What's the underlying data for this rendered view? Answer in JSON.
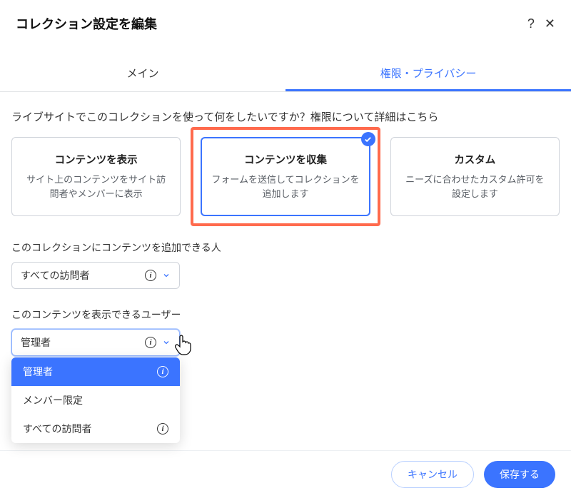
{
  "header": {
    "title": "コレクション設定を編集",
    "help": "?",
    "close": "✕"
  },
  "tabs": {
    "main": "メイン",
    "permissions": "権限・プライバシー"
  },
  "prompt": "ライブサイトでこのコレクションを使って何をしたいですか？権限について詳細はこちら",
  "cards": [
    {
      "title": "コンテンツを表示",
      "desc": "サイト上のコンテンツをサイト訪問者やメンバーに表示"
    },
    {
      "title": "コンテンツを収集",
      "desc": "フォームを送信してコレクションを追加します"
    },
    {
      "title": "カスタム",
      "desc": "ニーズに合わせたカスタム許可を設定します"
    }
  ],
  "add_section": {
    "label": "このコレクションにコンテンツを追加できる人",
    "value": "すべての訪問者"
  },
  "view_section": {
    "label": "このコンテンツを表示できるユーザー",
    "value": "管理者",
    "options": [
      "管理者",
      "メンバー限定",
      "すべての訪問者"
    ]
  },
  "footer": {
    "cancel": "キャンセル",
    "save": "保存する"
  }
}
